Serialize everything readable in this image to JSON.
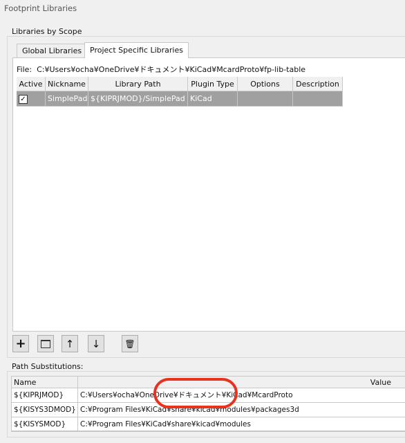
{
  "window": {
    "title": "Footprint Libraries"
  },
  "scope_group": {
    "label": "Libraries by Scope"
  },
  "tabs": [
    {
      "label": "Global Libraries",
      "active": false
    },
    {
      "label": "Project Specific Libraries",
      "active": true
    }
  ],
  "file": {
    "label": "File:",
    "path": "C:¥Users¥ocha¥OneDrive¥ドキュメント¥KiCad¥McardProto¥fp-lib-table"
  },
  "lib_table": {
    "columns": [
      "Active",
      "Nickname",
      "Library Path",
      "Plugin Type",
      "Options",
      "Description"
    ],
    "rows": [
      {
        "active": true,
        "nickname": "SimplePad",
        "path": "${KIPRJMOD}/SimplePad",
        "plugin": "KiCad",
        "options": "",
        "description": ""
      }
    ]
  },
  "toolbar": {
    "add": "add-icon",
    "browse": "folder-icon",
    "up": "arrow-up-icon",
    "down": "arrow-down-icon",
    "delete": "trash-icon"
  },
  "paths": {
    "label": "Path Substitutions:",
    "columns": [
      "Name",
      "Value"
    ],
    "rows": [
      {
        "name": "${KIPRJMOD}",
        "value": "C:¥Users¥ocha¥OneDrive¥ドキュメント¥KiCad¥McardProto"
      },
      {
        "name": "${KISYS3DMOD}",
        "value": "C:¥Program Files¥KiCad¥share¥kicad¥modules¥packages3d"
      },
      {
        "name": "${KISYSMOD}",
        "value": "C:¥Program Files¥KiCad¥share¥kicad¥modules"
      }
    ]
  },
  "colors": {
    "selected_row": "#a0a0a0",
    "highlight_ellipse": "#e8321e"
  }
}
